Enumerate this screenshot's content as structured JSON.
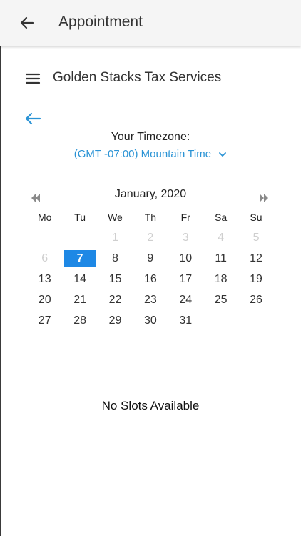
{
  "appbar": {
    "title": "Appointment"
  },
  "business": {
    "name": "Golden Stacks Tax Services"
  },
  "timezone": {
    "label": "Your Timezone:",
    "value": "(GMT -07:00) Mountain Time"
  },
  "calendar": {
    "month": "January, 2020",
    "weekdays": [
      "Mo",
      "Tu",
      "We",
      "Th",
      "Fr",
      "Sa",
      "Su"
    ],
    "weeks": [
      [
        "",
        "",
        "1",
        "2",
        "3",
        "4",
        "5"
      ],
      [
        "6",
        "7",
        "8",
        "9",
        "10",
        "11",
        "12"
      ],
      [
        "13",
        "14",
        "15",
        "16",
        "17",
        "18",
        "19"
      ],
      [
        "20",
        "21",
        "22",
        "23",
        "24",
        "25",
        "26"
      ],
      [
        "27",
        "28",
        "29",
        "30",
        "31",
        "",
        ""
      ]
    ],
    "selected": "7",
    "disabled": [
      "1",
      "2",
      "3",
      "4",
      "5",
      "6"
    ]
  },
  "slots": {
    "message": "No Slots Available"
  },
  "colors": {
    "accent": "#2a93d5",
    "selected_bg": "#1e88e5"
  },
  "icons": {
    "appbar_back": "arrow-left-icon",
    "menu": "hamburger-menu-icon",
    "calendar_back": "arrow-left-icon",
    "prev": "double-chevron-left-icon",
    "next": "double-chevron-right-icon",
    "dropdown": "chevron-down-icon"
  }
}
